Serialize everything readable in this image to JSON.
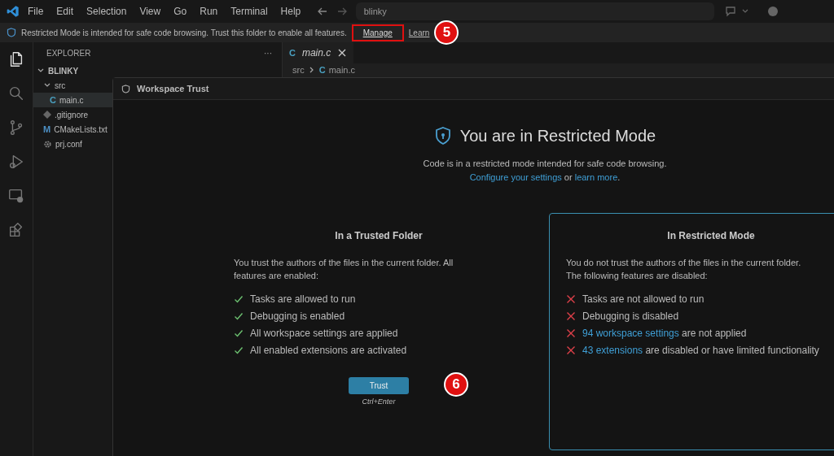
{
  "menu": [
    "File",
    "Edit",
    "Selection",
    "View",
    "Go",
    "Run",
    "Terminal",
    "Help"
  ],
  "search": {
    "value": "blinky"
  },
  "notice": {
    "text": "Restricted Mode is intended for safe code browsing. Trust this folder to enable all features.",
    "link": "Manage",
    "link2": "Learn",
    "highlighted": true
  },
  "activity": [
    {
      "kind": "files",
      "selected": true
    },
    {
      "kind": "search",
      "selected": false
    },
    {
      "kind": "git",
      "selected": false
    },
    {
      "kind": "debug",
      "selected": false
    },
    {
      "kind": "remote",
      "selected": false
    },
    {
      "kind": "extensions",
      "selected": false
    }
  ],
  "sidebar": {
    "title": "EXPLORER",
    "more": "···",
    "tree": [
      {
        "label": "BLINKY",
        "kind": "folder",
        "expanded": true,
        "root": true,
        "children": [
          {
            "label": "src",
            "kind": "folder",
            "expanded": true,
            "children": [
              {
                "label": "main.c",
                "kind": "c-file",
                "badge": "C",
                "selected": true
              }
            ]
          },
          {
            "label": ".gitignore",
            "kind": "ignore-file",
            "selected": false
          },
          {
            "label": "CMakeLists.txt",
            "kind": "cmake-file",
            "badge": "M",
            "selected": false
          },
          {
            "label": "prj.conf",
            "kind": "config-file",
            "selected": false
          }
        ]
      }
    ]
  },
  "editor": {
    "tab": {
      "badge": "C",
      "label": "main.c"
    },
    "breadcrumb": [
      {
        "label": "src"
      },
      {
        "badge": "C",
        "label": "main.c"
      }
    ]
  },
  "dialog": {
    "title": "Workspace Trust",
    "heading": "You are in Restricted Mode",
    "subtitle": "Code is in a restricted mode intended for safe code browsing.",
    "links": [
      {
        "kind": "link",
        "text": "Configure your settings"
      },
      {
        "kind": "text",
        "text": " or "
      },
      {
        "kind": "link",
        "text": "learn more"
      },
      {
        "kind": "text",
        "text": "."
      }
    ],
    "columns": [
      {
        "title": "In a Trusted Folder",
        "selected": false,
        "description": "You trust the authors of the files in the current folder. All features are enabled:",
        "items": [
          {
            "allowed": true,
            "text": "Tasks are allowed to run"
          },
          {
            "allowed": true,
            "text": "Debugging is enabled"
          },
          {
            "allowed": true,
            "text": "All workspace settings are applied"
          },
          {
            "allowed": true,
            "text": "All enabled extensions are activated"
          }
        ],
        "button": "Trust",
        "shortcut": "Ctrl+Enter"
      },
      {
        "title": "In Restricted Mode",
        "selected": true,
        "description": "You do not trust the authors of the files in the current folder. The following features are disabled:",
        "items": [
          {
            "allowed": false,
            "text": "Tasks are not allowed to run"
          },
          {
            "allowed": false,
            "text": "Debugging is disabled"
          },
          {
            "allowed": false,
            "link": "94 workspace settings",
            "text": " are not applied"
          },
          {
            "allowed": false,
            "link": "43 extensions",
            "text": " are disabled or have limited functionality"
          }
        ]
      }
    ]
  },
  "callouts": [
    "5",
    "6"
  ]
}
